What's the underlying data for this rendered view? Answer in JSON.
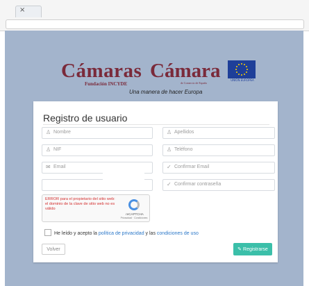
{
  "browser": {
    "tab_close": "×"
  },
  "logos": {
    "camaras_big": "Cámaras",
    "camaras_sub": "Fundación INCYDE",
    "camara_big": "Cámara",
    "camara_sub": "de Comercio de España",
    "eu_caption": "UNIÓN EUROPEA"
  },
  "tagline": "Una manera de hacer Europa",
  "form": {
    "title": "Registro de usuario",
    "nombre_placeholder": "Nombre",
    "apellidos_placeholder": "Apellidos",
    "nif_placeholder": "NIF",
    "telefono_placeholder": "Teléfono",
    "email_placeholder": "Email",
    "confirmar_email_placeholder": "Confirmar Email",
    "confirmar_contrasena_placeholder": "Confirmar contraseña",
    "recaptcha_error": "ERROR para el propietario del sitio web: el dominio de la clave de sitio web no es válido",
    "recaptcha_brand": "reCAPTCHA",
    "recaptcha_links": "Privacidad · Condiciones",
    "terms_prefix": "He leído y acepto la",
    "privacy_link": "política de privacidad",
    "terms_and": "y las",
    "conditions_link": "condiciones de uso",
    "back_label": "Volver",
    "register_label": "Registrarse"
  },
  "icons": {
    "user": "user-icon",
    "id": "id-icon",
    "phone": "phone-icon",
    "email": "envelope-icon",
    "check": "check-icon",
    "register": "register-icon"
  },
  "colors": {
    "page_bg": "#a3b4cc",
    "logo": "#7a2a3a",
    "eu_blue": "#1e3f99",
    "register_button": "#3bbfa9",
    "error_text": "#d32f2f",
    "link": "#2a77c8"
  }
}
